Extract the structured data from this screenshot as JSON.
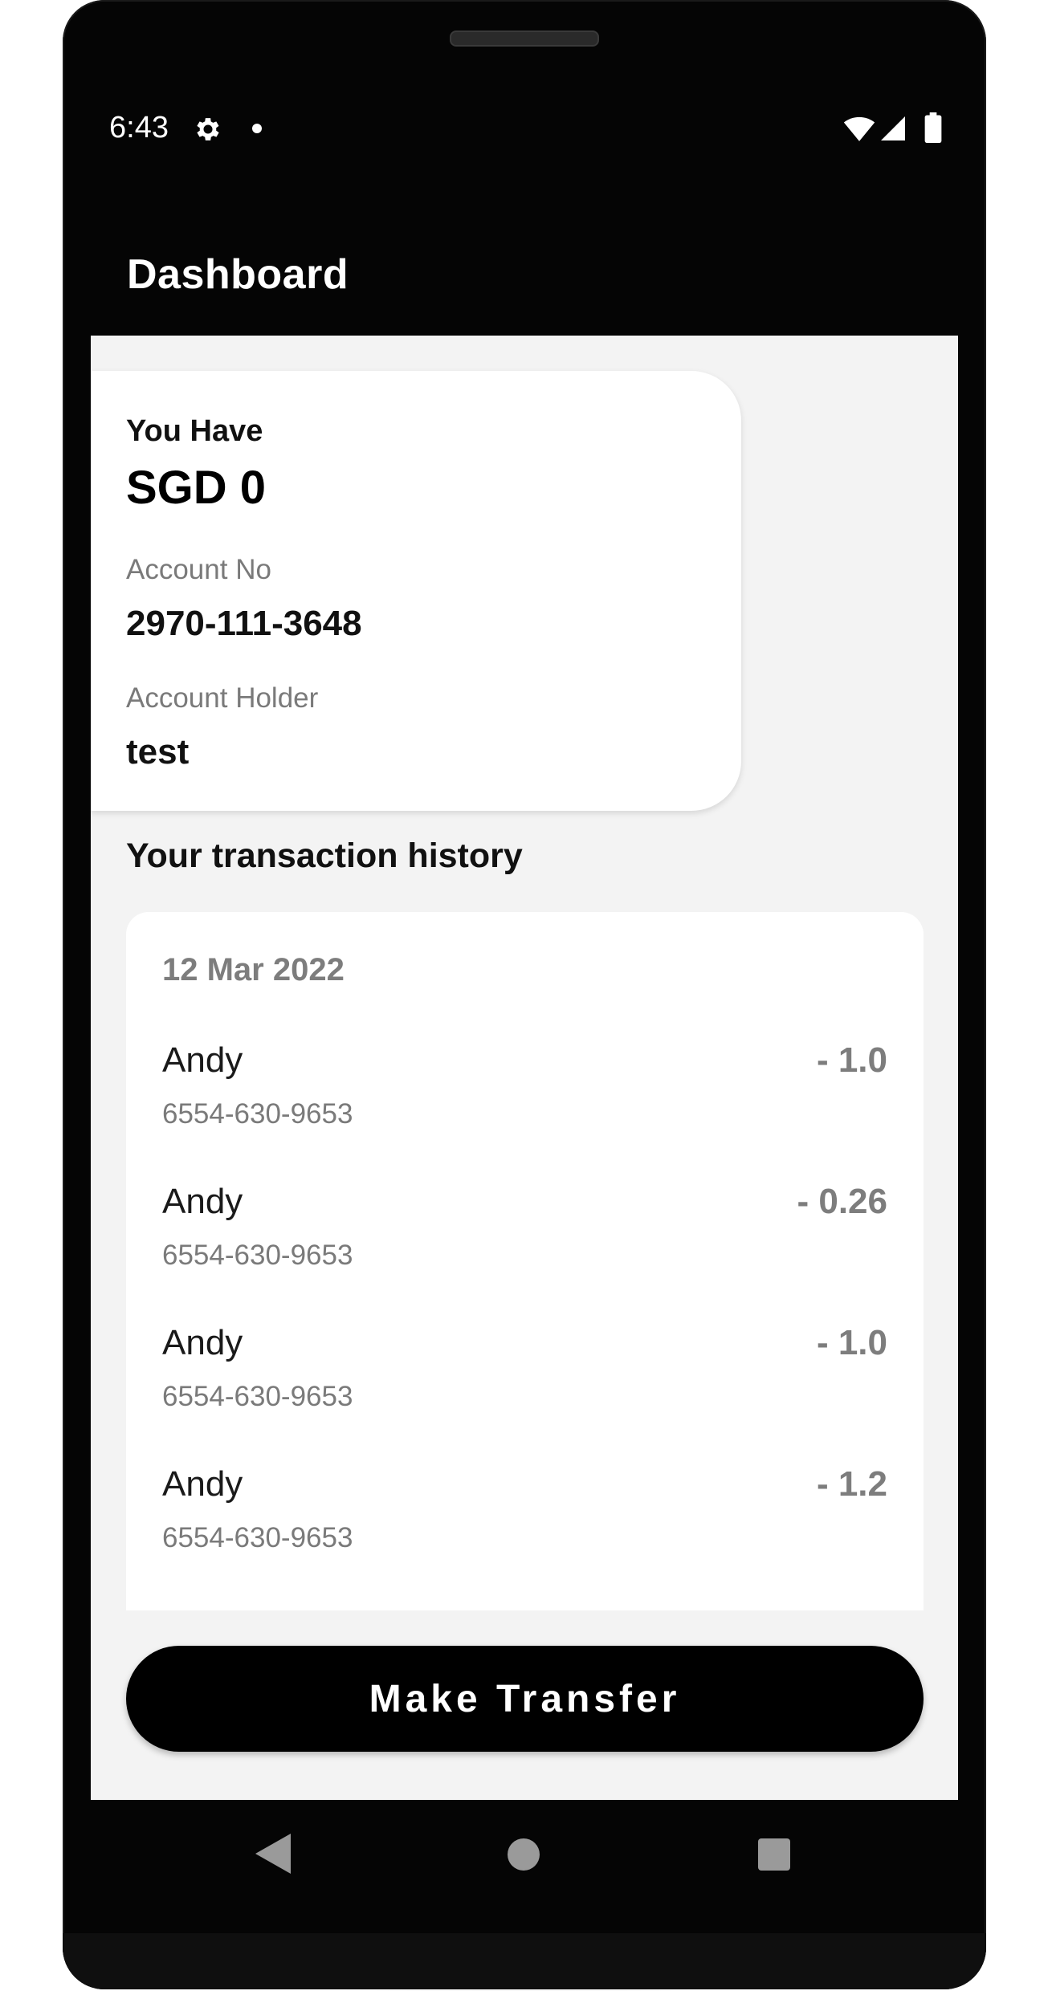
{
  "status_bar": {
    "time": "6:43",
    "icons": [
      "gear-icon",
      "notification-dot-icon",
      "wifi-icon",
      "signal-icon",
      "battery-icon"
    ]
  },
  "app_bar": {
    "title": "Dashboard"
  },
  "balance_card": {
    "label": "You Have",
    "balance": "SGD 0",
    "account_no_label": "Account No",
    "account_no": "2970-111-3648",
    "holder_label": "Account Holder",
    "holder": "test"
  },
  "history": {
    "title": "Your transaction history",
    "date": "12 Mar 2022",
    "transactions": [
      {
        "name": "Andy",
        "account": "6554-630-9653",
        "amount": "- 1.0"
      },
      {
        "name": "Andy",
        "account": "6554-630-9653",
        "amount": "- 0.26"
      },
      {
        "name": "Andy",
        "account": "6554-630-9653",
        "amount": "- 1.0"
      },
      {
        "name": "Andy",
        "account": "6554-630-9653",
        "amount": "- 1.2"
      }
    ]
  },
  "actions": {
    "transfer_label": "Make Transfer"
  },
  "nav_bar": {
    "icons": [
      "back-icon",
      "home-icon",
      "recents-icon"
    ]
  },
  "colors": {
    "background": "#f3f3f3",
    "primary": "#000000",
    "muted_text": "#7a7a7a"
  }
}
